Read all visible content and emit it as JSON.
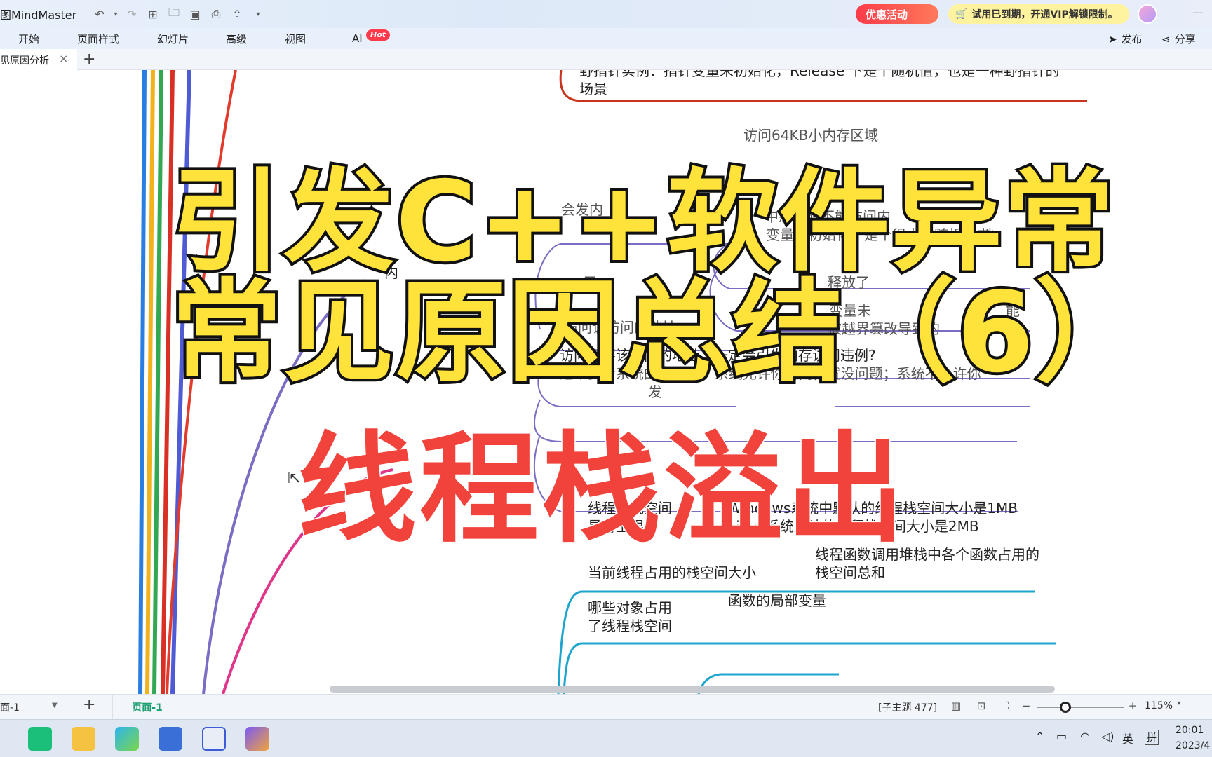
{
  "window": {
    "title": "图MindMaster"
  },
  "quick_access": [
    "undo",
    "undo-menu",
    "redo",
    "new",
    "open",
    "save",
    "print",
    "export",
    "customize"
  ],
  "promo": {
    "label": "优惠活动",
    "vip_text": "试用已到期，开通VIP解锁限制。"
  },
  "menu": {
    "items": [
      "开始",
      "页面样式",
      "幻灯片",
      "高级",
      "视图",
      "AI"
    ],
    "hot_badge": "Hot",
    "publish": "发布",
    "share": "分享"
  },
  "tab": {
    "doc_name": "见原因分析",
    "close": "×",
    "add": "+"
  },
  "mindmap": {
    "nodes": [
      "野指针实例：指针变量未初始化，Release 下是个随机值，也是一种野指针的",
      "场景",
      "访问64KB小内存区域",
      "会发内",
      "中态代码不能访问内",
      "的内",
      "变量未初始化，是个很大的随机值内",
      "地",
      "内",
      "已",
      "释放了",
      "变量未",
      "能",
      "访问该访问的地址",
      "被越界篡改导致的",
      "访问了不该访问的地址，一定会引发内存访问违例?",
      "这个要看系统的“脸色”，系统允许你访问，就没问题；系统不允许你",
      "发",
      "释",
      "线程的栈空间",
      "是有上限的",
      "Windows系统中默认的线程栈空间大小是1MB",
      "Linux系统默认的线程栈空间大小是2MB",
      "当前线程占用的栈空间大小",
      "线程函数调用堆栈中各个函数占用的",
      "栈空间总和",
      "哪些对象占用",
      "了线程栈空间",
      "函数的局部变量"
    ]
  },
  "overlay": {
    "line1": "引发C++软件异常",
    "line2": "常见原因总结（6）",
    "line3": "线程栈溢出"
  },
  "status": {
    "page_select": "面-1",
    "add": "+",
    "page_tab": "页面-1",
    "topic_count": "[子主题 477]",
    "zoom": "115%",
    "zoom_level": 0.33
  },
  "taskbar": {
    "ime_lang": "英",
    "ime_mode": "拼",
    "time": "20:01",
    "date": "2023/4"
  },
  "colors": {
    "accent": "#1a9f6e",
    "yellow_title": "#ffe23a",
    "red_title": "#f1433b",
    "branch_cyan": "#1ea5cf",
    "branch_purple": "#7b6cc4",
    "branch_red": "#c9341f",
    "branch_pink": "#e0368a"
  }
}
